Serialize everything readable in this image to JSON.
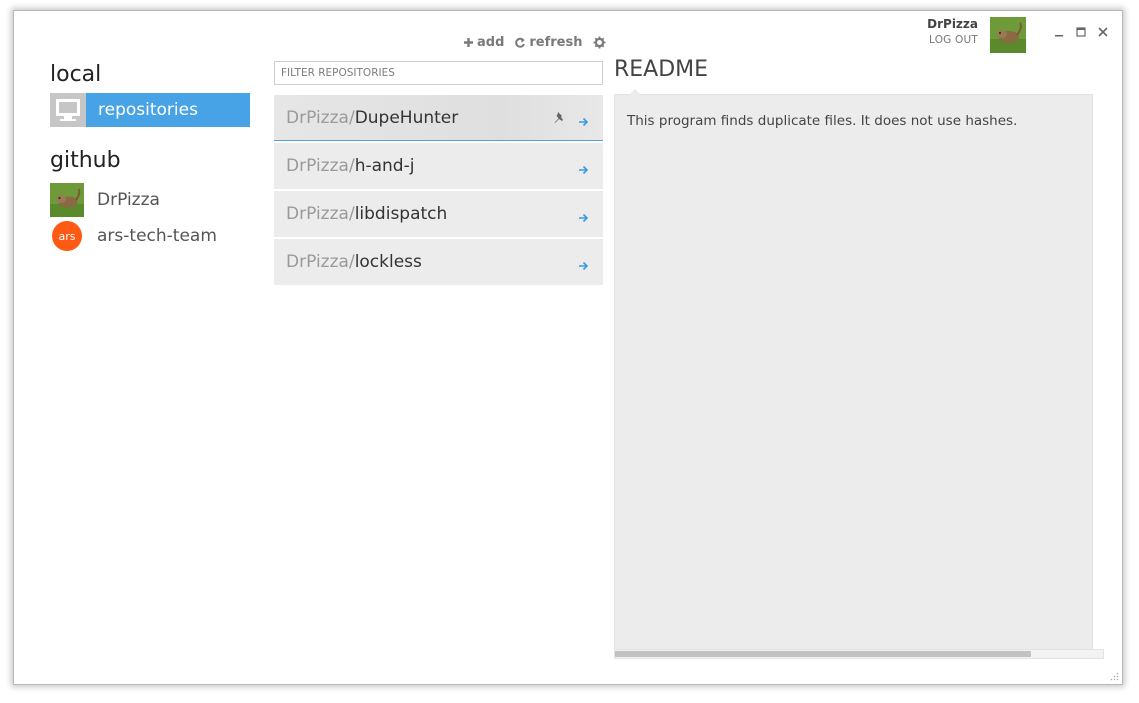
{
  "window": {
    "controls": {
      "minimize": "minimize",
      "maximize": "maximize",
      "close": "close"
    }
  },
  "user": {
    "name": "DrPizza",
    "logout_label": "LOG OUT"
  },
  "toolbar": {
    "add_label": "add",
    "refresh_label": "refresh"
  },
  "nav": {
    "local_heading": "local",
    "local_items": [
      {
        "label": "repositories",
        "icon": "computer-icon",
        "selected": true
      }
    ],
    "github_heading": "github",
    "github_items": [
      {
        "label": "DrPizza",
        "icon": "user-avatar"
      },
      {
        "label": "ars-tech-team",
        "icon": "org-avatar",
        "avatar_text": "ars"
      }
    ]
  },
  "filter": {
    "placeholder": "FILTER REPOSITORIES",
    "value": ""
  },
  "repos": [
    {
      "owner": "DrPizza/",
      "name": "DupeHunter",
      "selected": true,
      "pinned": true
    },
    {
      "owner": "DrPizza/",
      "name": "h-and-j"
    },
    {
      "owner": "DrPizza/",
      "name": "libdispatch"
    },
    {
      "owner": "DrPizza/",
      "name": "lockless"
    }
  ],
  "readme": {
    "title": "README",
    "text": "This program finds duplicate files. It does not use hashes."
  },
  "colors": {
    "accent": "#47a3e6",
    "org": "#ff5a14",
    "pane": "#ececec"
  }
}
